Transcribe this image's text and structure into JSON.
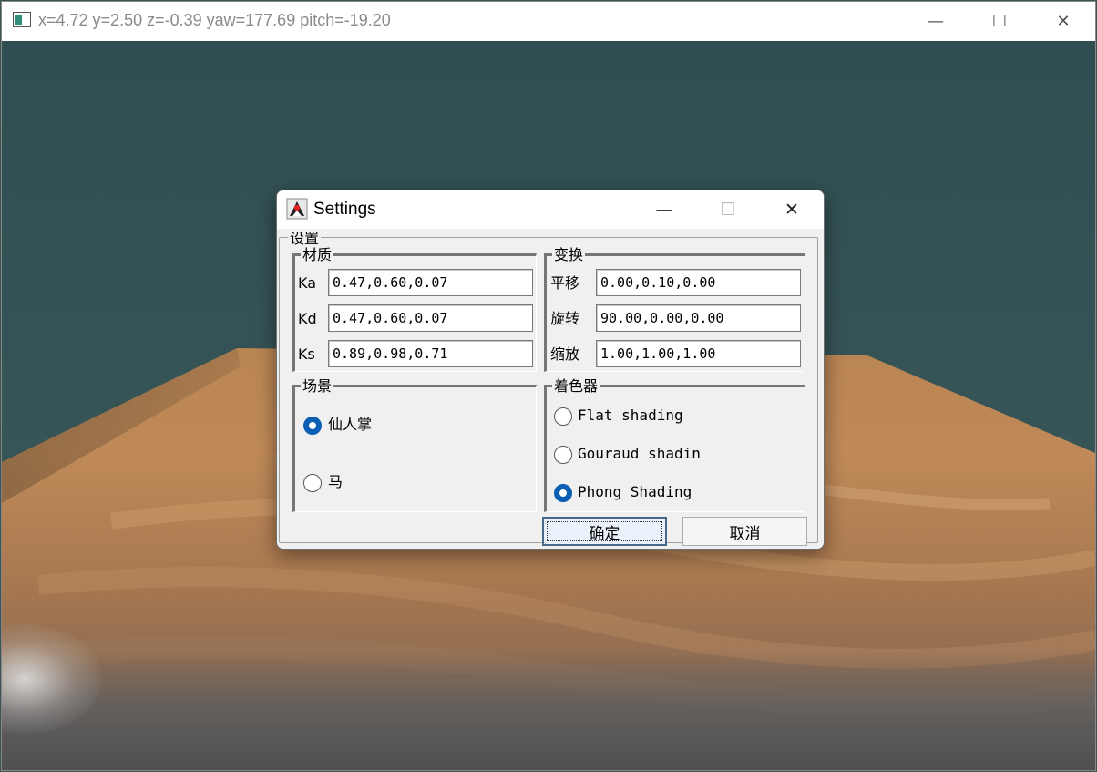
{
  "main_window": {
    "title": "x=4.72 y=2.50 z=-0.39 yaw=177.69 pitch=-19.20",
    "controls": {
      "minimize": "—",
      "maximize": "☐",
      "close": "✕"
    }
  },
  "colors": {
    "sky": "#355356",
    "floor_wood": "#b07a48",
    "dialog_bg": "#f0f0f0",
    "radio_selected": "#0a5fb4"
  },
  "dialog": {
    "title": "Settings",
    "icon": "java-duke-icon",
    "controls": {
      "minimize": "—",
      "maximize": "☐",
      "close": "✕"
    },
    "settings_legend": "设置",
    "material": {
      "legend": "材质",
      "fields": [
        {
          "label": "Ka",
          "value": "0.47,0.60,0.07"
        },
        {
          "label": "Kd",
          "value": "0.47,0.60,0.07"
        },
        {
          "label": "Ks",
          "value": "0.89,0.98,0.71"
        }
      ]
    },
    "transform": {
      "legend": "变换",
      "fields": [
        {
          "label": "平移",
          "value": "0.00,0.10,0.00"
        },
        {
          "label": "旋转",
          "value": "90.00,0.00,0.00"
        },
        {
          "label": "缩放",
          "value": "1.00,1.00,1.00"
        }
      ]
    },
    "scene": {
      "legend": "场景",
      "options": [
        {
          "label": "仙人掌",
          "selected": true
        },
        {
          "label": "马",
          "selected": false
        }
      ]
    },
    "shader": {
      "legend": "着色器",
      "options": [
        {
          "label": "Flat shading",
          "selected": false
        },
        {
          "label": "Gouraud shadin",
          "selected": false
        },
        {
          "label": "Phong Shading",
          "selected": true
        }
      ]
    },
    "buttons": {
      "ok": "确定",
      "cancel": "取消"
    }
  }
}
